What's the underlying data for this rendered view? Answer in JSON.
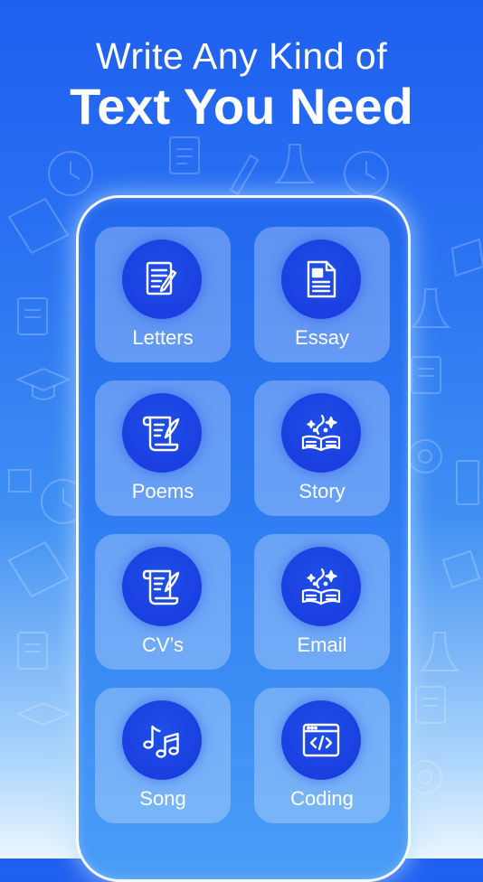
{
  "headline": {
    "line1": "Write Any Kind of",
    "line2": "Text You Need"
  },
  "categories": [
    {
      "label": "Letters",
      "icon": "letter-pen-icon"
    },
    {
      "label": "Essay",
      "icon": "document-icon"
    },
    {
      "label": "Poems",
      "icon": "scroll-quill-icon"
    },
    {
      "label": "Story",
      "icon": "magic-book-icon"
    },
    {
      "label": "CV’s",
      "icon": "scroll-quill-icon"
    },
    {
      "label": "Email",
      "icon": "magic-book-icon"
    },
    {
      "label": "Song",
      "icon": "music-notes-icon"
    },
    {
      "label": "Coding",
      "icon": "code-window-icon"
    }
  ],
  "colors": {
    "background_top": "#1f5ff0",
    "background_bottom": "#eaf6ff",
    "icon_circle": "#1a3fe0",
    "text": "#ffffff"
  }
}
